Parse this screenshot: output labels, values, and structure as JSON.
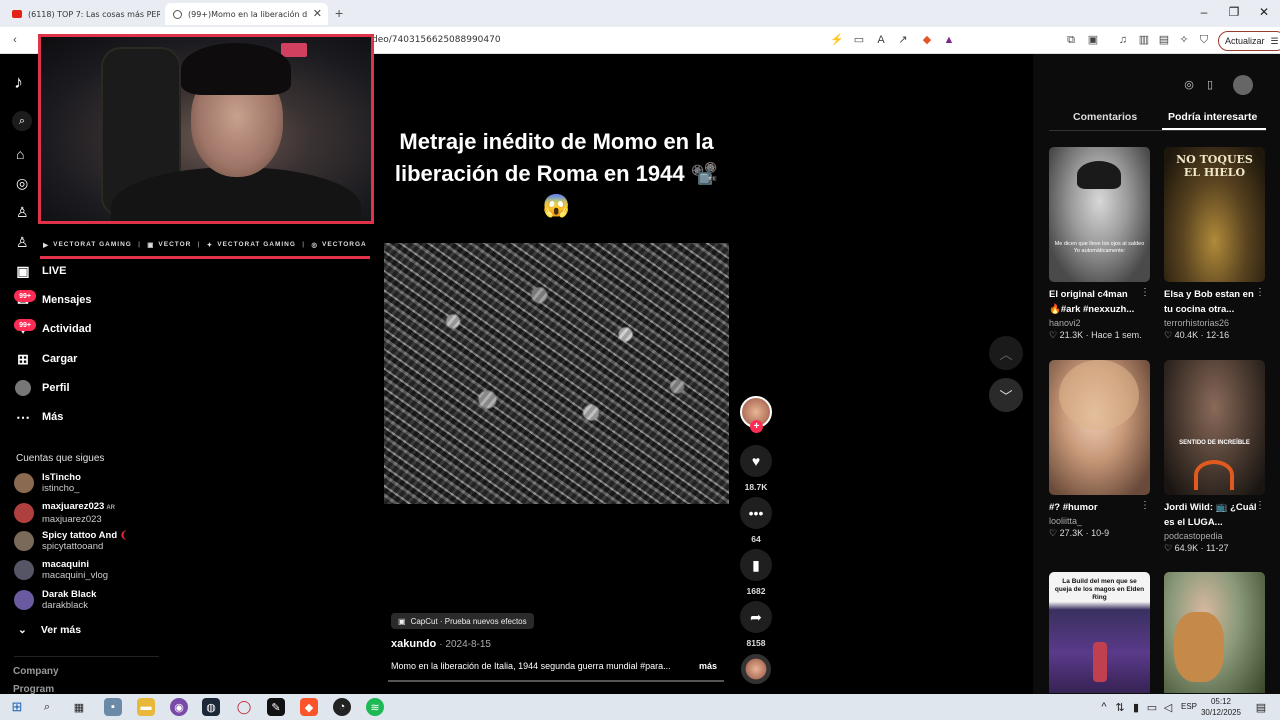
{
  "browser": {
    "tabs": [
      {
        "label": "(6118) TOP 7: Las cosas más PERTURB",
        "active": false
      },
      {
        "label": "(99+)Momo en la liberación d",
        "active": true
      }
    ],
    "new_tab": "+",
    "url": "deo/7403156625088990470",
    "update_label": "Actualizar",
    "window_controls": [
      "–",
      "❐",
      "✕"
    ]
  },
  "sidebar": {
    "nav": [
      {
        "label": "LIVE",
        "icon": "live-icon"
      },
      {
        "label": "Mensajes",
        "icon": "messages-icon",
        "badge": "99+"
      },
      {
        "label": "Actividad",
        "icon": "activity-icon",
        "badge": "99+"
      },
      {
        "label": "Cargar",
        "icon": "upload-icon"
      },
      {
        "label": "Perfil",
        "icon": "profile-icon"
      },
      {
        "label": "Más",
        "icon": "more-icon"
      }
    ],
    "following_title": "Cuentas que sigues",
    "accounts": [
      {
        "name": "IsTincho",
        "handle": "istincho_",
        "color": "#8a6a50"
      },
      {
        "name": "maxjuarez023",
        "suffix": "AR",
        "handle": "maxjuarez023",
        "color": "#b04040"
      },
      {
        "name": "Spicy tattoo And",
        "handle": "spicytattooand",
        "color": "#7a6a5a"
      },
      {
        "name": "macaquini",
        "handle": "macaquini_vlog",
        "color": "#555566"
      },
      {
        "name": "Darak Black",
        "handle": "darakblack",
        "color": "#6a5aa0"
      }
    ],
    "see_more": "Ver más",
    "footer": [
      "Company",
      "Program"
    ]
  },
  "stream": {
    "socials": [
      {
        "label": "VECTORAT GAMING",
        "icon": "youtube-icon"
      },
      {
        "label": "VECTOR",
        "icon": "twitch-icon"
      },
      {
        "label": "VECTORAT GAMING",
        "icon": "twitter-icon"
      },
      {
        "label": "VECTORGA",
        "icon": "instagram-icon"
      }
    ]
  },
  "video": {
    "caption": "Metraje inédito de Momo en la liberación de Roma en 1944 📽️😱",
    "effect_label": "CapCut · Prueba nuevos efectos",
    "author": "xakundo",
    "date": "· 2024-8-15",
    "description": "Momo en la liberación de Italia, 1944 segunda guerra mundial #para...",
    "more": "más",
    "likes": "18.7K",
    "comments": "64",
    "saves": "1682",
    "shares": "8158"
  },
  "right_panel": {
    "tabs": [
      "Comentarios",
      "Podría interesarte"
    ],
    "cards": [
      {
        "title": "El original c4man 🔥#ark #nexxuzh...",
        "author": "hanovi2",
        "likes": "21.3K",
        "when": "Hace 1 sem.",
        "overlay": "Me dicen que lleve los ojos al saldeo Yo automáticamente:"
      },
      {
        "title": "Elsa y Bob estan en tu cocina otra...",
        "author": "terrorhistorias26",
        "likes": "40.4K",
        "when": "12-16",
        "overlay": "NO TOQUES EL HIELO"
      },
      {
        "title": "#? #humor",
        "author": "looliitta_",
        "likes": "27.3K",
        "when": "10-9",
        "overlay": ""
      },
      {
        "title": "Jordi Wild: 📺 ¿Cuál es el LUGA...",
        "author": "podcastopedia",
        "likes": "64.9K",
        "when": "11-27",
        "overlay": "SENTIDO DE INCREÍBLE"
      },
      {
        "title": "",
        "author": "",
        "likes": "",
        "when": "",
        "overlay": "La Build del men que se queja de los magos en Elden Ring"
      },
      {
        "title": "",
        "author": "",
        "likes": "",
        "when": "",
        "overlay": ""
      }
    ]
  },
  "taskbar": {
    "lang": "ESP",
    "time": "05:12",
    "date": "30/12/2025"
  }
}
